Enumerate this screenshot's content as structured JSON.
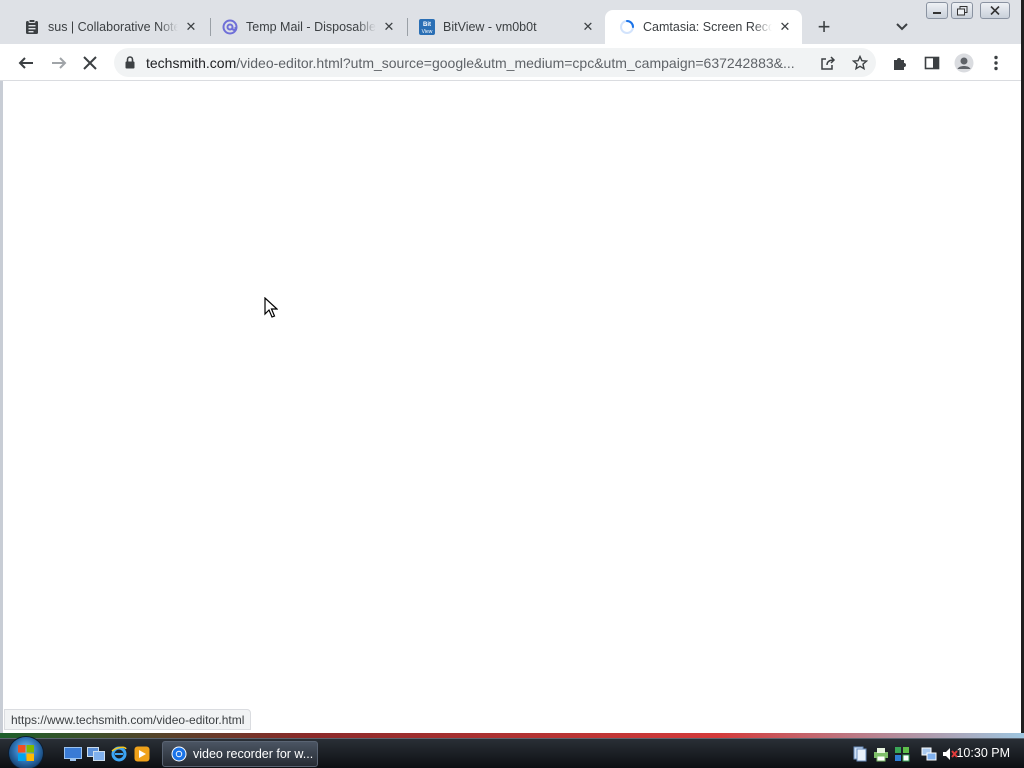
{
  "browser": {
    "tabs": [
      {
        "title": "sus | Collaborative Notep",
        "favicon": "clipboard-icon",
        "active": false
      },
      {
        "title": "Temp Mail - Disposable T",
        "favicon": "at-sign-icon",
        "active": false
      },
      {
        "title": "BitView - vm0b0t",
        "favicon": "bitview-icon",
        "favicon_text": "Bit View",
        "active": false
      },
      {
        "title": "Camtasia: Screen Record",
        "favicon": "loading-spinner-icon",
        "active": true
      }
    ],
    "new_tab_label": "+",
    "address_bar": {
      "host": "techsmith.com",
      "path": "/video-editor.html?utm_source=google&utm_medium=cpc&utm_campaign=637242883&..."
    },
    "status_url": "https://www.techsmith.com/video-editor.html",
    "loading": true
  },
  "taskbar": {
    "active_window_label": "video recorder for w...",
    "clock": "10:30 PM"
  },
  "colors": {
    "accent": "#1a73e8",
    "tabstrip_bg": "#dee1e6",
    "taskbar_bg": "#1a1e24"
  }
}
